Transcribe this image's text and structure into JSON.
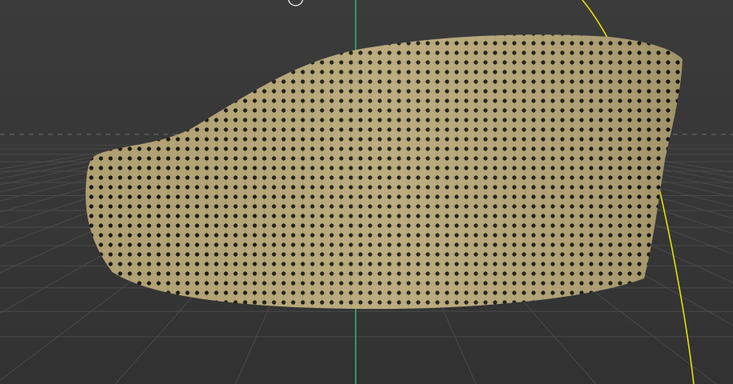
{
  "viewport": {
    "colors": {
      "background_top": "#3b3b3b",
      "background_bottom": "#323232",
      "grid_line": "#4a4a4a",
      "horizon_dash": "#6e6e6e",
      "axis_z": "#2ecc71",
      "curve": "#e6e000",
      "band_base": "#b8a878",
      "band_dot": "#1a1a14",
      "gizmo_ring": "#d8d8d8"
    },
    "objects": [
      {
        "name": "perforated-band-mesh",
        "material": "dot-pattern-texture"
      },
      {
        "name": "yellow-curve",
        "kind": "nurbs-curve"
      },
      {
        "name": "green-z-axis",
        "kind": "axis"
      },
      {
        "name": "ground-grid",
        "kind": "grid"
      },
      {
        "name": "gizmo-ring",
        "kind": "manipulator"
      }
    ]
  }
}
